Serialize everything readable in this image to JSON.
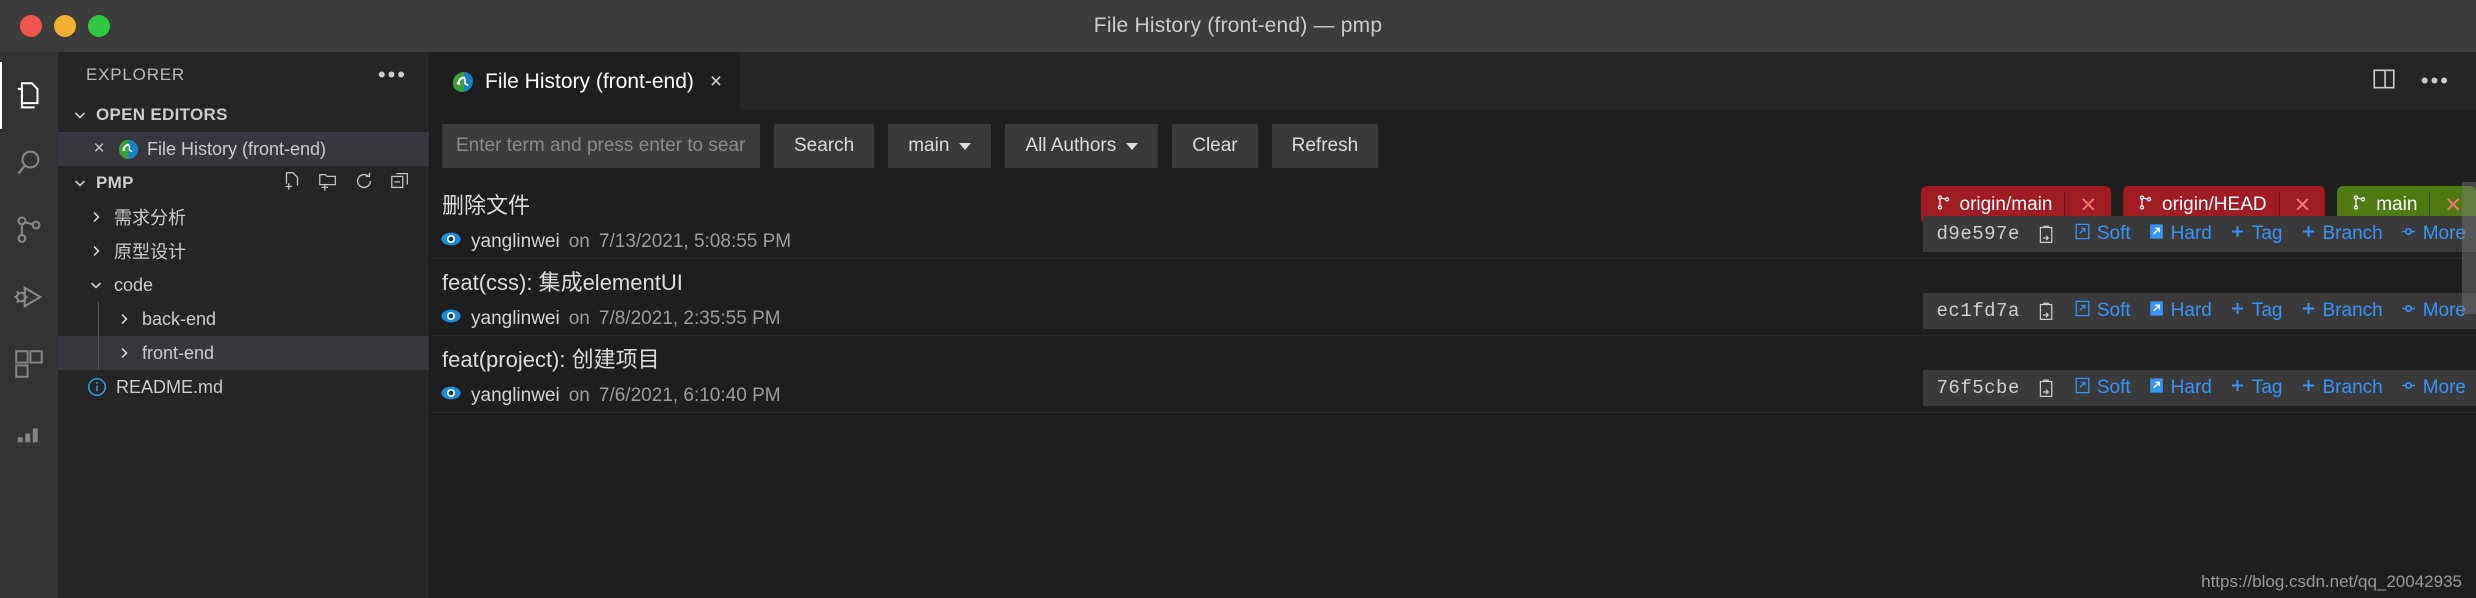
{
  "window": {
    "title": "File History (front-end) — pmp",
    "traffic_lights": [
      "close-red",
      "minimize-yellow",
      "zoom-green"
    ]
  },
  "activity_bar": {
    "items": [
      {
        "name": "explorer",
        "icon": "files-icon",
        "active": true
      },
      {
        "name": "search",
        "icon": "search-icon",
        "active": false
      },
      {
        "name": "source-control",
        "icon": "source-control-icon",
        "active": false
      },
      {
        "name": "run-and-debug",
        "icon": "debug-icon",
        "active": false
      },
      {
        "name": "extensions",
        "icon": "extensions-icon",
        "active": false
      }
    ]
  },
  "sidebar": {
    "header": {
      "title": "EXPLORER",
      "more_label": "•••"
    },
    "open_editors": {
      "label": "OPEN EDITORS",
      "expanded": true,
      "items": [
        {
          "label": "File History (front-end)",
          "close": "×",
          "icon": "gitlens-file-history-icon",
          "selected": true
        }
      ]
    },
    "project": {
      "label": "PMP",
      "expanded": true,
      "actions": [
        "new-file-icon",
        "new-folder-icon",
        "refresh-icon",
        "collapse-all-icon"
      ],
      "items": [
        {
          "label": "需求分析",
          "type": "folder",
          "expanded": false,
          "depth": 1,
          "selected": false
        },
        {
          "label": "原型设计",
          "type": "folder",
          "expanded": false,
          "depth": 1,
          "selected": false
        },
        {
          "label": "code",
          "type": "folder",
          "expanded": true,
          "depth": 1,
          "selected": false
        },
        {
          "label": "back-end",
          "type": "folder",
          "expanded": false,
          "depth": 2,
          "selected": false
        },
        {
          "label": "front-end",
          "type": "folder",
          "expanded": false,
          "depth": 2,
          "selected": true
        },
        {
          "label": "README.md",
          "type": "file",
          "icon": "info-icon",
          "depth": 1,
          "selected": false
        }
      ]
    }
  },
  "editor": {
    "tab": {
      "label": "File History (front-end)",
      "icon": "gitlens-file-history-icon",
      "close": "×",
      "active": true
    },
    "tab_actions": {
      "split_label": "split-editor-icon",
      "more_label": "•••"
    }
  },
  "toolbar": {
    "search_value": "",
    "search_placeholder": "Enter term and press enter to search",
    "search_button": "Search",
    "branch_select": "main",
    "authors_select": "All Authors",
    "clear_button": "Clear",
    "refresh_button": "Refresh"
  },
  "commits": [
    {
      "subject": "删除文件",
      "author": "yanglinwei",
      "date_prefix": "on",
      "date": "7/13/2021, 5:08:55 PM",
      "hash": "d9e597e",
      "refs": [
        {
          "label": "origin/main",
          "kind": "remote",
          "close": "✕"
        },
        {
          "label": "origin/HEAD",
          "kind": "remote",
          "close": "✕"
        },
        {
          "label": "main",
          "kind": "local",
          "close": "✕"
        }
      ],
      "actions": [
        {
          "label": "Soft",
          "icon": "soft-reset-icon"
        },
        {
          "label": "Hard",
          "icon": "hard-reset-icon"
        },
        {
          "label": "Tag",
          "icon": "plus-icon"
        },
        {
          "label": "Branch",
          "icon": "plus-icon"
        },
        {
          "label": "More",
          "icon": "more-commit-icon"
        }
      ]
    },
    {
      "subject": "feat(css): 集成elementUI",
      "author": "yanglinwei",
      "date_prefix": "on",
      "date": "7/8/2021, 2:35:55 PM",
      "hash": "ec1fd7a",
      "refs": [],
      "actions": [
        {
          "label": "Soft",
          "icon": "soft-reset-icon"
        },
        {
          "label": "Hard",
          "icon": "hard-reset-icon"
        },
        {
          "label": "Tag",
          "icon": "plus-icon"
        },
        {
          "label": "Branch",
          "icon": "plus-icon"
        },
        {
          "label": "More",
          "icon": "more-commit-icon"
        }
      ]
    },
    {
      "subject": "feat(project): 创建项目",
      "author": "yanglinwei",
      "date_prefix": "on",
      "date": "7/6/2021, 6:10:40 PM",
      "hash": "76f5cbe",
      "refs": [],
      "actions": [
        {
          "label": "Soft",
          "icon": "soft-reset-icon"
        },
        {
          "label": "Hard",
          "icon": "hard-reset-icon"
        },
        {
          "label": "Tag",
          "icon": "plus-icon"
        },
        {
          "label": "Branch",
          "icon": "plus-icon"
        },
        {
          "label": "More",
          "icon": "more-commit-icon"
        }
      ]
    }
  ],
  "watermark": "https://blog.csdn.net/qq_20042935",
  "colors": {
    "accent_link": "#3794ff",
    "remote_ref_bg": "#a01b22",
    "local_ref_bg": "#4f7a12",
    "eye_blue": "#1c8ad6",
    "titlebar_bg": "#3c3c3c",
    "sidebar_bg": "#252526",
    "editor_bg": "#1e1e1e",
    "activity_bg": "#333333"
  }
}
